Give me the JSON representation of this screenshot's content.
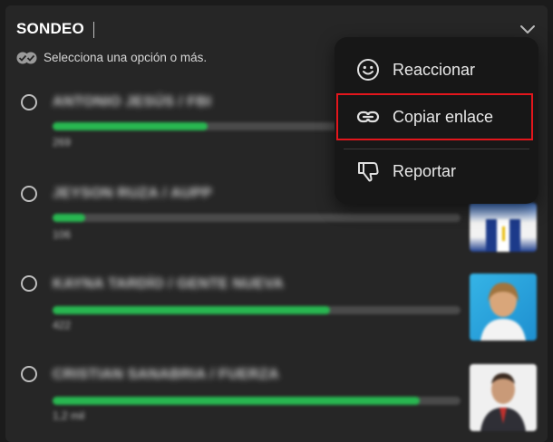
{
  "poll": {
    "title": "SONDEO",
    "subtitle": "Selecciona una opción o más.",
    "options": [
      {
        "label": "ANTONIO JESÚS / FBI",
        "count": "269",
        "fraction": 0.38
      },
      {
        "label": "JEYSON RUZA / AUPP",
        "count": "106",
        "fraction": 0.08
      },
      {
        "label": "KAYNA TARDÍO / GENTE NUEVA",
        "count": "422",
        "fraction": 0.68
      },
      {
        "label": "CRISTIAN SANABRIA / FUERZA",
        "count": "1,2 mil",
        "fraction": 0.9
      }
    ]
  },
  "menu": {
    "items": [
      {
        "label": "Reaccionar",
        "icon": "smiley-icon"
      },
      {
        "label": "Copiar enlace",
        "icon": "link-icon"
      },
      {
        "label": "Reportar",
        "icon": "thumbs-down-icon"
      }
    ]
  },
  "colors": {
    "accent": "#28b750",
    "highlight": "#e3161c",
    "menu_bg": "#171717",
    "panel_bg": "#262626"
  }
}
